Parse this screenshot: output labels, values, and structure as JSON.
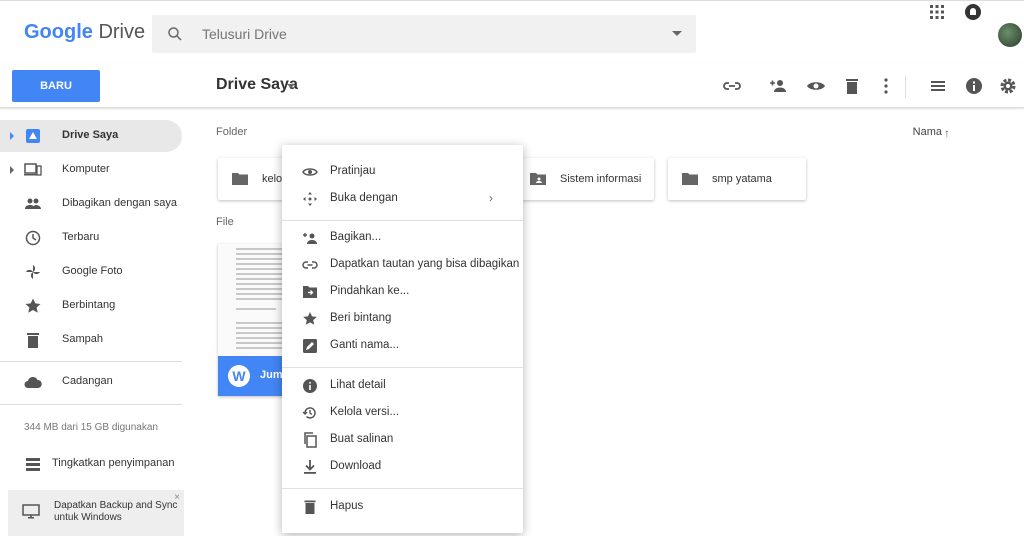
{
  "header": {
    "logo_google": "Google",
    "logo_drive": "Drive",
    "search_placeholder": "Telusuri Drive"
  },
  "toolbar": {
    "new_label": "BARU",
    "title": "Drive Saya"
  },
  "sidebar": {
    "items": [
      {
        "label": "Drive Saya",
        "icon": "drive-icon"
      },
      {
        "label": "Komputer",
        "icon": "computer-icon"
      },
      {
        "label": "Dibagikan dengan saya",
        "icon": "people-icon"
      },
      {
        "label": "Terbaru",
        "icon": "clock-icon"
      },
      {
        "label": "Google Foto",
        "icon": "pinwheel-icon"
      },
      {
        "label": "Berbintang",
        "icon": "star-icon"
      },
      {
        "label": "Sampah",
        "icon": "trash-icon"
      },
      {
        "label": "Cadangan",
        "icon": "cloud-icon"
      }
    ],
    "storage": "344 MB dari 15 GB digunakan",
    "upgrade": "Tingkatkan penyimpanan",
    "backup": "Dapatkan Backup and Sync untuk Windows",
    "backup_close": "×"
  },
  "main": {
    "folder_label": "Folder",
    "file_label": "File",
    "sort_label": "Nama",
    "sort_arrow": "↑",
    "folders": [
      {
        "label": "kelon"
      },
      {
        "label": "Sistem informasi"
      },
      {
        "label": "smp yatama"
      }
    ],
    "file": {
      "name": "Juma",
      "icon_letter": "W"
    }
  },
  "context_menu": {
    "items": [
      {
        "label": "Pratinjau"
      },
      {
        "label": "Buka dengan",
        "chevron": "›"
      },
      {
        "label": "Bagikan..."
      },
      {
        "label": "Dapatkan tautan yang bisa dibagikan"
      },
      {
        "label": "Pindahkan ke..."
      },
      {
        "label": "Beri bintang"
      },
      {
        "label": "Ganti nama..."
      },
      {
        "label": "Lihat detail"
      },
      {
        "label": "Kelola versi..."
      },
      {
        "label": "Buat salinan"
      },
      {
        "label": "Download"
      },
      {
        "label": "Hapus"
      }
    ]
  },
  "colors": {
    "accent": "#4285f4",
    "icon_gray": "#5f6368"
  }
}
